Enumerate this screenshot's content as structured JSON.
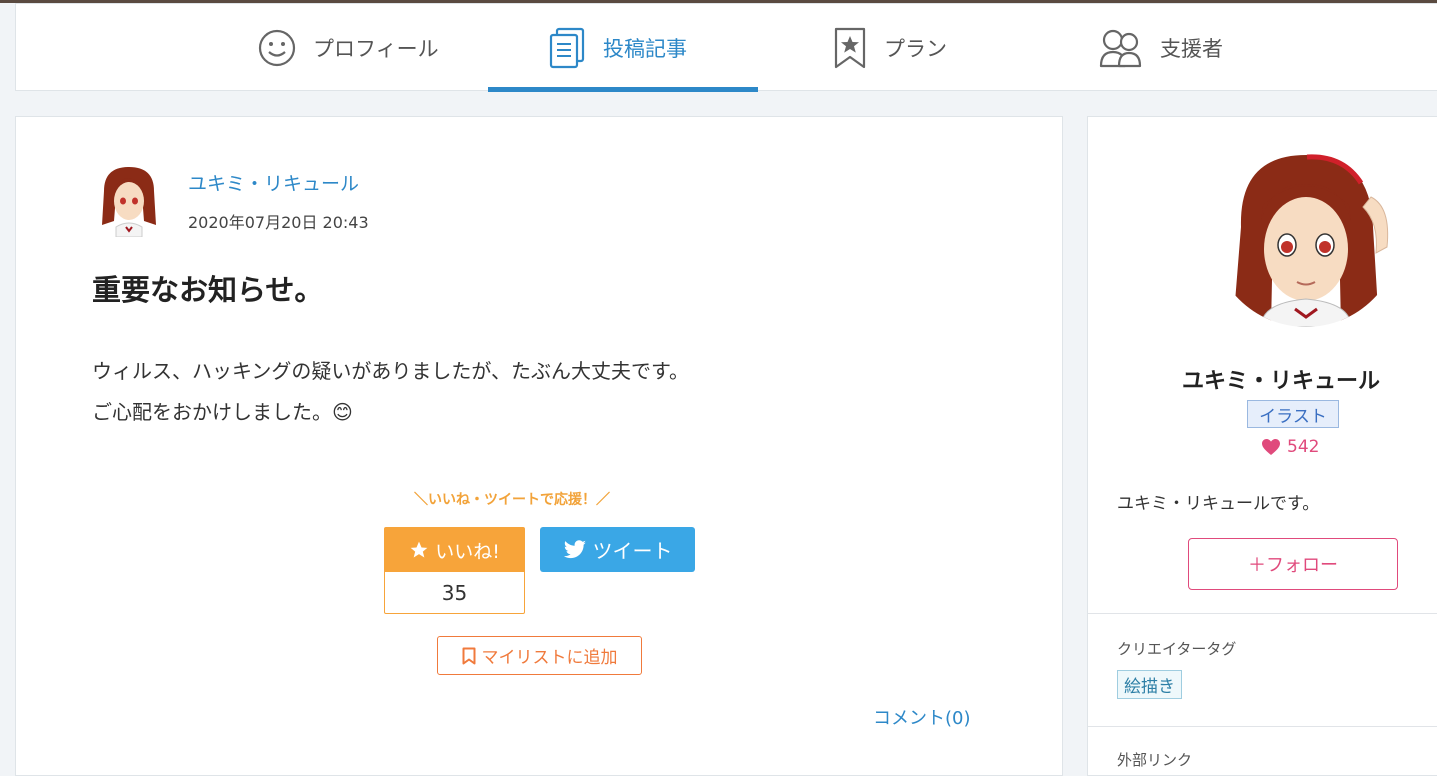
{
  "nav": {
    "tabs": [
      {
        "label": "プロフィール",
        "icon": "smiley-icon"
      },
      {
        "label": "投稿記事",
        "icon": "document-icon",
        "active": true
      },
      {
        "label": "プラン",
        "icon": "bookmark-star-icon"
      },
      {
        "label": "支援者",
        "icon": "people-icon"
      }
    ]
  },
  "post": {
    "author": "ユキミ・リキュール",
    "date": "2020年07月20日 20:43",
    "title": "重要なお知らせ。",
    "body_line1": "ウィルス、ハッキングの疑いがありましたが、たぶん大丈夫です。",
    "body_line2": "ご心配をおかけしました。",
    "body_emoji": "😊",
    "support_banner": "＼いいね・ツイートで応援！／",
    "like_label": "いいね!",
    "like_count": "35",
    "tweet_label": "ツイート",
    "mylist_label": "マイリストに追加",
    "comment_link": "コメント(0)"
  },
  "sidebar": {
    "name": "ユキミ・リキュール",
    "category": "イラスト",
    "likes": "542",
    "description": "ユキミ・リキュールです。",
    "follow_label": "＋フォロー",
    "creator_tags_label": "クリエイタータグ",
    "tags": [
      "絵描き"
    ],
    "external_links_label": "外部リンク"
  },
  "colors": {
    "accent_blue": "#2d88c8",
    "like_orange": "#f7a43a",
    "twitter_blue": "#3aa7e6",
    "pink": "#e04a7c"
  }
}
